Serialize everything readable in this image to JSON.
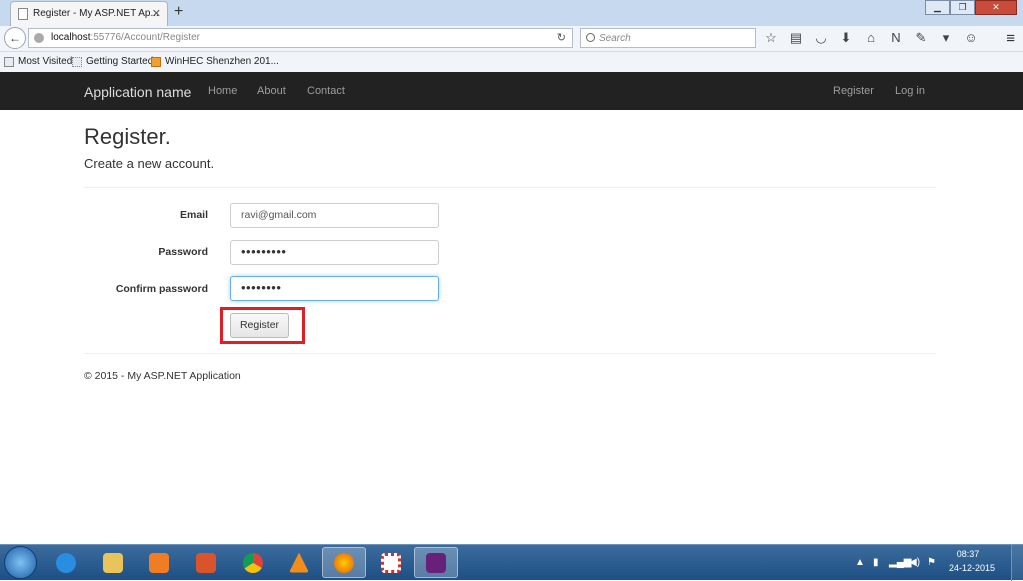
{
  "browser": {
    "tab_title": "Register - My ASP.NET Ap...",
    "url_host": "localhost",
    "url_path": ":55776/Account/Register",
    "search_placeholder": "Search",
    "bookmarks": [
      "Most Visited",
      "Getting Started",
      "WinHEC Shenzhen 201..."
    ]
  },
  "site": {
    "brand": "Application name",
    "nav_left": [
      "Home",
      "About",
      "Contact"
    ],
    "nav_right": [
      "Register",
      "Log in"
    ]
  },
  "page": {
    "title": "Register.",
    "subtitle": "Create a new account.",
    "form": {
      "email_label": "Email",
      "email_value": "ravi@gmail.com",
      "password_label": "Password",
      "password_value": "•••••••••",
      "confirm_label": "Confirm password",
      "confirm_value": "••••••••",
      "submit_label": "Register"
    },
    "footer": "© 2015 - My ASP.NET Application"
  },
  "taskbar": {
    "time": "08:37",
    "date": "24-12-2015"
  },
  "colors": {
    "highlight": "#e01e26",
    "navbar": "#222222",
    "focus_border": "#66afe9"
  }
}
